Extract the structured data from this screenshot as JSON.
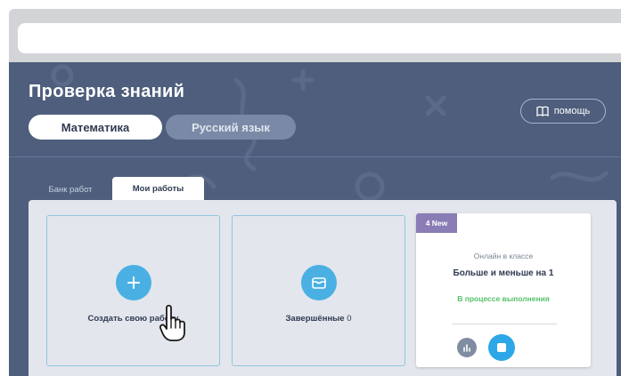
{
  "app": {
    "title": "Проверка знаний",
    "subjects": [
      {
        "label": "Математика",
        "active": true
      },
      {
        "label": "Русский язык",
        "active": false
      }
    ],
    "help_label": "помощь"
  },
  "tabs": [
    {
      "label": "Банк работ",
      "active": false
    },
    {
      "label": "Мои работы",
      "active": true
    }
  ],
  "cards": {
    "create": {
      "label": "Создать свою работу",
      "icon": "plus-icon"
    },
    "completed": {
      "label": "Завершённые",
      "count": "0",
      "icon": "archive-box-icon"
    },
    "online": {
      "badge": "4 New",
      "subtitle": "Онлайн в классе",
      "name": "Больше и меньше на 1",
      "status": "В процессе выполнения",
      "status_color": "#56c06a",
      "actions": [
        "bar-chart-icon",
        "stop-icon"
      ]
    }
  },
  "colors": {
    "app_background": "#4e5e7c",
    "accent": "#4ab0e3",
    "badge": "#8a7cb5"
  }
}
